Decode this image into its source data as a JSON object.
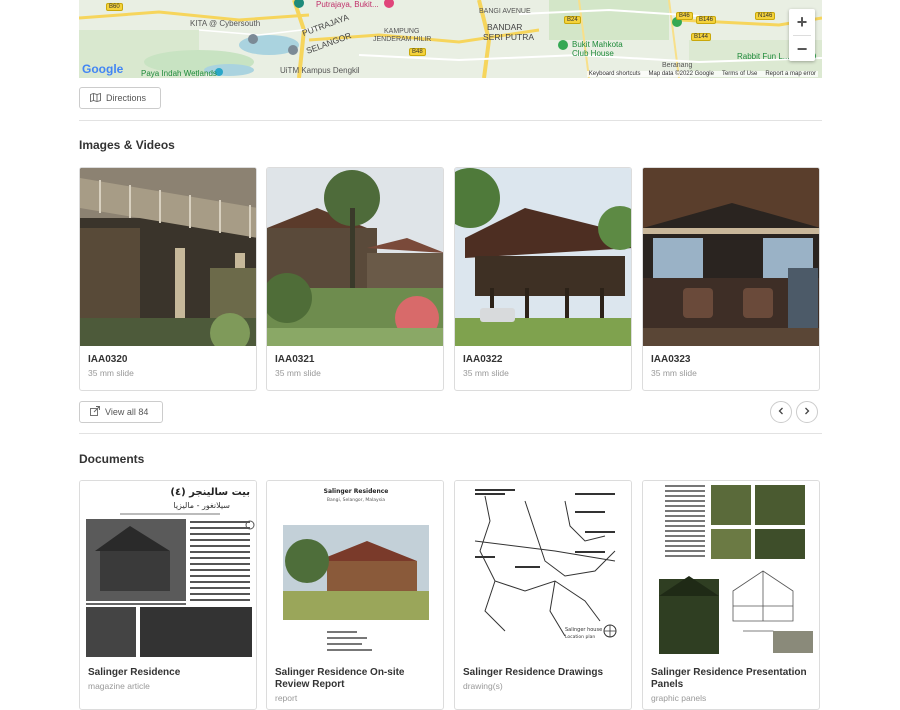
{
  "map": {
    "places": {
      "putrajaya_bukit": "Putrajaya, Bukit...",
      "kita": "KITA @ Cybersouth",
      "putrajaya": "PUTRAJAYA",
      "selangor": "SELANGOR",
      "kampung": "KAMPUNG",
      "jenderam": "JENDERAM HILIR",
      "bangi_avenue": "BANGI AVENUE",
      "bandar": "BANDAR",
      "seri_putra": "SERI PUTRA",
      "bukit_mahkota": "Bukit Mahkota",
      "club_house": "Club House",
      "rabbit_fun": "Rabbit Fun L...",
      "paya_indah": "Paya Indah Wetlands",
      "uitm": "UiTM Kampus Dengkil",
      "beranang": "Beranang"
    },
    "road_badges": [
      "B60",
      "B24",
      "B46",
      "B48",
      "B146",
      "N146",
      "B144"
    ],
    "google_logo": "Google",
    "footer": {
      "keyboard": "Keyboard shortcuts",
      "map_data": "Map data ©2022 Google",
      "terms": "Terms of Use",
      "report": "Report a map error"
    },
    "zoom_in": "+",
    "zoom_out": "−"
  },
  "directions_label": "Directions",
  "images_section": {
    "title": "Images & Videos",
    "items": [
      {
        "title": "IAA0320",
        "sub": "35 mm slide"
      },
      {
        "title": "IAA0321",
        "sub": "35 mm slide"
      },
      {
        "title": "IAA0322",
        "sub": "35 mm slide"
      },
      {
        "title": "IAA0323",
        "sub": "35 mm slide"
      }
    ],
    "view_all": "View all 84"
  },
  "documents_section": {
    "title": "Documents",
    "items": [
      {
        "title": "Salinger Residence",
        "sub": "magazine article"
      },
      {
        "title": "Salinger Residence On-site Review Report",
        "sub": "report"
      },
      {
        "title": "Salinger Residence Drawings",
        "sub": "drawing(s)"
      },
      {
        "title": "Salinger Residence Presentation Panels",
        "sub": "graphic panels"
      }
    ],
    "doc1_heading": "(٤) بيت سالينجر",
    "doc1_subheading": "سيلانغور - ماليزيا",
    "doc2_heading": "Salinger Residence",
    "doc2_subheading": "Bangi, Selangor, Malaysia",
    "doc3_caption": "Salinger house",
    "doc3_caption2": "Location plan"
  },
  "colors": {
    "map_bg": "#e9efe3",
    "road_yellow": "#f6d55c",
    "water": "#aad3df",
    "park": "#c8e6c0"
  }
}
